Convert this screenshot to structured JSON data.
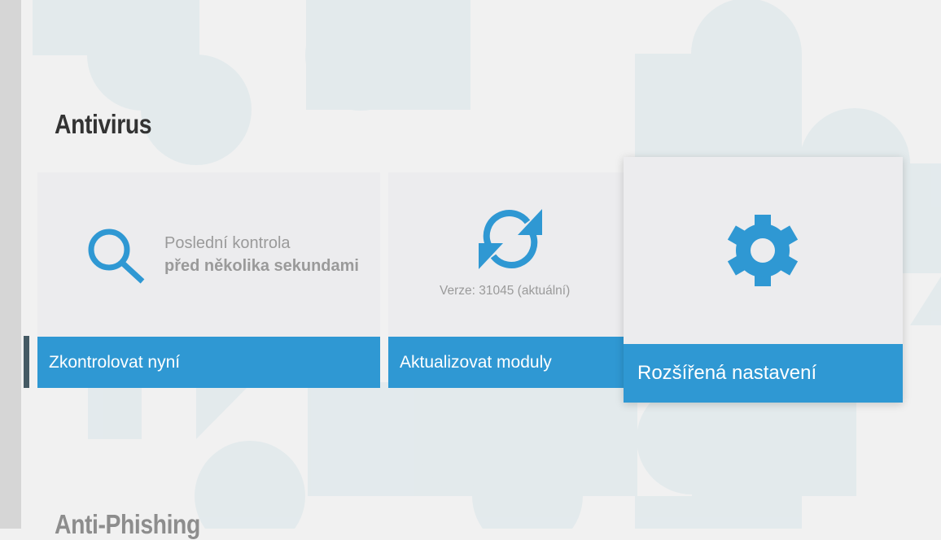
{
  "sections": {
    "antivirus_title": "Antivirus",
    "antiphishing_title": "Anti-Phishing"
  },
  "scan_tile": {
    "label": "Poslední kontrola",
    "value": "před několika sekundami",
    "button_label": "Zkontrolovat nyní",
    "icon": "search-icon"
  },
  "update_tile": {
    "version_text": "Verze: 31045 (aktuální)",
    "button_label": "Aktualizovat moduly",
    "icon": "refresh-icon"
  },
  "settings_tile": {
    "button_label": "Rozšířená nastavení",
    "icon": "gear-icon"
  },
  "colors": {
    "accent": "#2f98d3",
    "tile_background": "#ececee",
    "page_background": "#f1f1f1",
    "title_text": "#333333",
    "muted_text": "#9a9a9a",
    "rail_marker": "#455a64"
  }
}
